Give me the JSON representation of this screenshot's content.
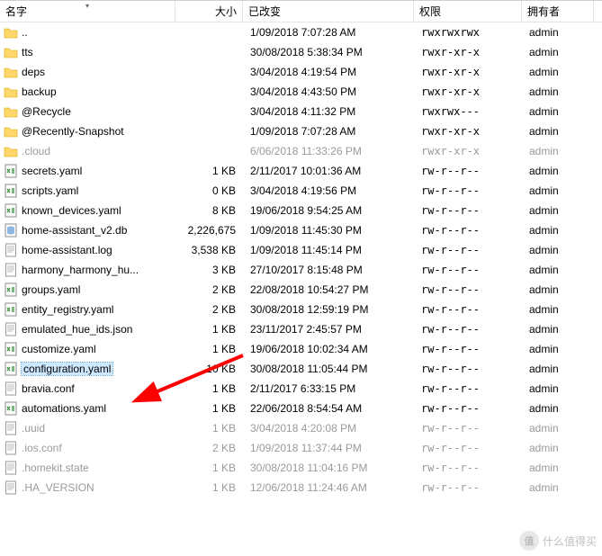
{
  "headers": {
    "name": "名字",
    "size": "大小",
    "changed": "已改变",
    "rights": "权限",
    "owner": "拥有者"
  },
  "rows": [
    {
      "icon": "folder-up",
      "name": "..",
      "size": "",
      "mtime": "1/09/2018 7:07:28 AM",
      "perm": "rwxrwxrwx",
      "owner": "admin",
      "dim": false
    },
    {
      "icon": "folder",
      "name": "tts",
      "size": "",
      "mtime": "30/08/2018 5:38:34 PM",
      "perm": "rwxr-xr-x",
      "owner": "admin",
      "dim": false
    },
    {
      "icon": "folder",
      "name": "deps",
      "size": "",
      "mtime": "3/04/2018 4:19:54 PM",
      "perm": "rwxr-xr-x",
      "owner": "admin",
      "dim": false
    },
    {
      "icon": "folder",
      "name": "backup",
      "size": "",
      "mtime": "3/04/2018 4:43:50 PM",
      "perm": "rwxr-xr-x",
      "owner": "admin",
      "dim": false
    },
    {
      "icon": "folder-sys",
      "name": "@Recycle",
      "size": "",
      "mtime": "3/04/2018 4:11:32 PM",
      "perm": "rwxrwx---",
      "owner": "admin",
      "dim": false
    },
    {
      "icon": "folder-sys",
      "name": "@Recently-Snapshot",
      "size": "",
      "mtime": "1/09/2018 7:07:28 AM",
      "perm": "rwxr-xr-x",
      "owner": "admin",
      "dim": false
    },
    {
      "icon": "folder",
      "name": ".cloud",
      "size": "",
      "mtime": "6/06/2018 11:33:26 PM",
      "perm": "rwxr-xr-x",
      "owner": "admin",
      "dim": true
    },
    {
      "icon": "yaml",
      "name": "secrets.yaml",
      "size": "1 KB",
      "mtime": "2/11/2017 10:01:36 AM",
      "perm": "rw-r--r--",
      "owner": "admin",
      "dim": false
    },
    {
      "icon": "yaml",
      "name": "scripts.yaml",
      "size": "0 KB",
      "mtime": "3/04/2018 4:19:56 PM",
      "perm": "rw-r--r--",
      "owner": "admin",
      "dim": false
    },
    {
      "icon": "yaml",
      "name": "known_devices.yaml",
      "size": "8 KB",
      "mtime": "19/06/2018 9:54:25 AM",
      "perm": "rw-r--r--",
      "owner": "admin",
      "dim": false
    },
    {
      "icon": "db",
      "name": "home-assistant_v2.db",
      "size": "2,226,675",
      "mtime": "1/09/2018 11:45:30 PM",
      "perm": "rw-r--r--",
      "owner": "admin",
      "dim": false
    },
    {
      "icon": "file",
      "name": "home-assistant.log",
      "size": "3,538 KB",
      "mtime": "1/09/2018 11:45:14 PM",
      "perm": "rw-r--r--",
      "owner": "admin",
      "dim": false
    },
    {
      "icon": "file",
      "name": "harmony_harmony_hu...",
      "size": "3 KB",
      "mtime": "27/10/2017 8:15:48 PM",
      "perm": "rw-r--r--",
      "owner": "admin",
      "dim": false
    },
    {
      "icon": "yaml",
      "name": "groups.yaml",
      "size": "2 KB",
      "mtime": "22/08/2018 10:54:27 PM",
      "perm": "rw-r--r--",
      "owner": "admin",
      "dim": false
    },
    {
      "icon": "yaml",
      "name": "entity_registry.yaml",
      "size": "2 KB",
      "mtime": "30/08/2018 12:59:19 PM",
      "perm": "rw-r--r--",
      "owner": "admin",
      "dim": false
    },
    {
      "icon": "file",
      "name": "emulated_hue_ids.json",
      "size": "1 KB",
      "mtime": "23/11/2017 2:45:57 PM",
      "perm": "rw-r--r--",
      "owner": "admin",
      "dim": false
    },
    {
      "icon": "yaml",
      "name": "customize.yaml",
      "size": "1 KB",
      "mtime": "19/06/2018 10:02:34 AM",
      "perm": "rw-r--r--",
      "owner": "admin",
      "dim": false
    },
    {
      "icon": "yaml",
      "name": "configuration.yaml",
      "size": "10 KB",
      "mtime": "30/08/2018 11:05:44 PM",
      "perm": "rw-r--r--",
      "owner": "admin",
      "dim": false,
      "selected": true
    },
    {
      "icon": "file",
      "name": "bravia.conf",
      "size": "1 KB",
      "mtime": "2/11/2017 6:33:15 PM",
      "perm": "rw-r--r--",
      "owner": "admin",
      "dim": false
    },
    {
      "icon": "yaml",
      "name": "automations.yaml",
      "size": "1 KB",
      "mtime": "22/06/2018 8:54:54 AM",
      "perm": "rw-r--r--",
      "owner": "admin",
      "dim": false
    },
    {
      "icon": "file",
      "name": ".uuid",
      "size": "1 KB",
      "mtime": "3/04/2018 4:20:08 PM",
      "perm": "rw-r--r--",
      "owner": "admin",
      "dim": true
    },
    {
      "icon": "file",
      "name": ".ios.conf",
      "size": "2 KB",
      "mtime": "1/09/2018 11:37:44 PM",
      "perm": "rw-r--r--",
      "owner": "admin",
      "dim": true
    },
    {
      "icon": "file",
      "name": ".homekit.state",
      "size": "1 KB",
      "mtime": "30/08/2018 11:04:16 PM",
      "perm": "rw-r--r--",
      "owner": "admin",
      "dim": true
    },
    {
      "icon": "file",
      "name": ".HA_VERSION",
      "size": "1 KB",
      "mtime": "12/06/2018 11:24:46 AM",
      "perm": "rw-r--r--",
      "owner": "admin",
      "dim": true
    }
  ],
  "watermark": "什么值得买",
  "icons": {
    "folder-up": "folder-up-icon",
    "folder": "folder-icon",
    "folder-sys": "folder-system-icon",
    "yaml": "yaml-file-icon",
    "db": "database-file-icon",
    "file": "generic-file-icon"
  }
}
